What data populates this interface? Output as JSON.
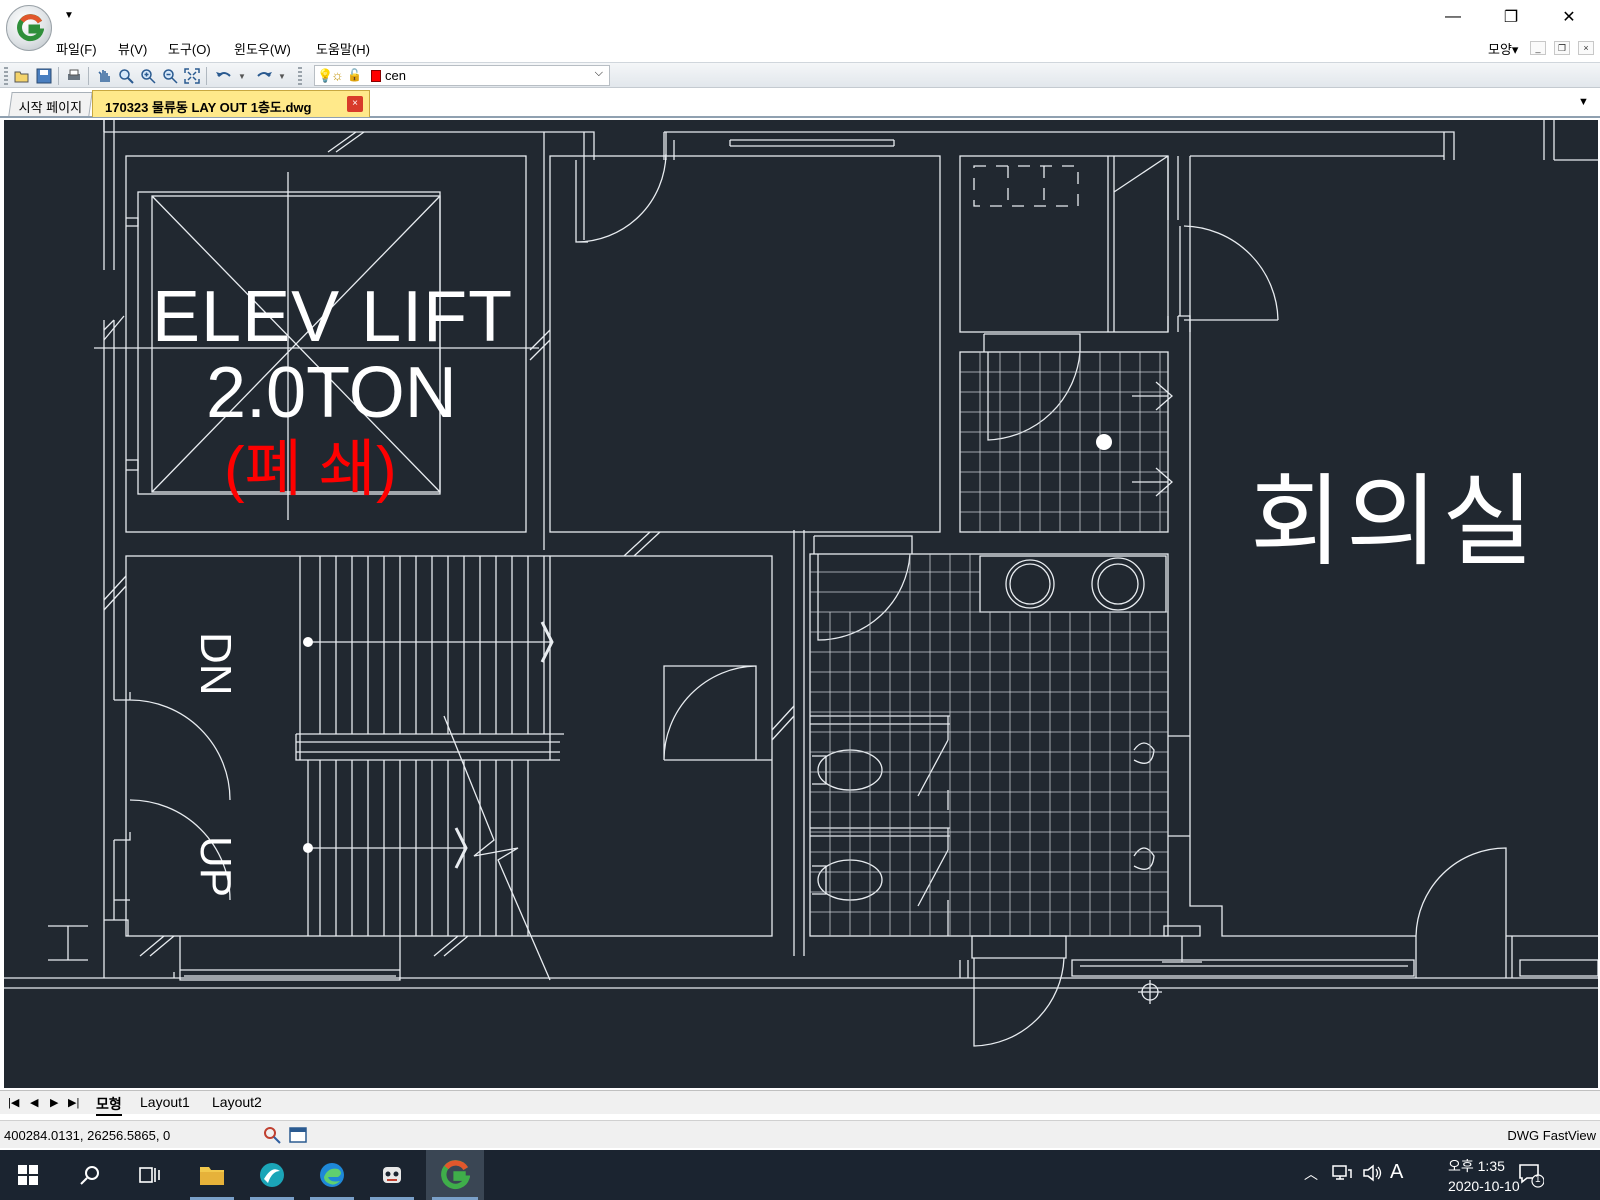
{
  "window": {
    "title_icon": "dwg-fastview-logo",
    "controls": {
      "minimize": "—",
      "restore": "❐",
      "close": "✕"
    }
  },
  "menu": {
    "items": [
      "파일(F)",
      "뷰(V)",
      "도구(O)",
      "윈도우(W)",
      "도움말(H)"
    ],
    "view_style": "모양▾"
  },
  "toolbar": {
    "icons": [
      "open-icon",
      "save-icon",
      "print-icon",
      "pan-icon",
      "zoom-icon",
      "zoom-in-icon",
      "zoom-out-icon",
      "zoom-extents-icon",
      "undo-icon",
      "redo-icon"
    ],
    "layer_combo": {
      "value": "cen",
      "color": "#ff0000"
    }
  },
  "tabs": {
    "start": "시작 페이지",
    "document": "170323 물류동 LAY OUT 1층도.dwg",
    "close": "×"
  },
  "drawing": {
    "background": "#212830",
    "texts": {
      "elev": "ELEV LIFT",
      "ton": "2.0TON",
      "closed": "(폐 쇄)",
      "room": "회의실",
      "dn": "DN",
      "up": "UP"
    }
  },
  "layout_tabs": {
    "model": "모형",
    "layout1": "Layout1",
    "layout2": "Layout2"
  },
  "status": {
    "coords": "400284.0131, 26256.5865, 0",
    "app_name": "DWG FastView"
  },
  "taskbar": {
    "time": "오후 1:35",
    "date": "2020-10-10",
    "ime": "A",
    "notification_count": "1"
  }
}
